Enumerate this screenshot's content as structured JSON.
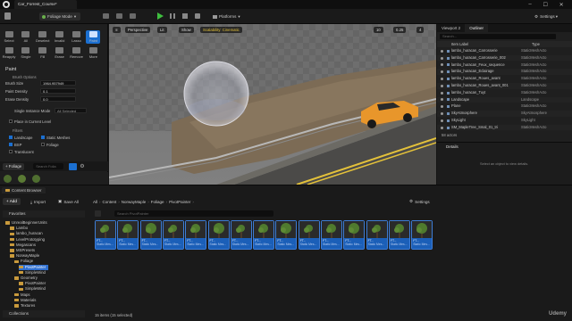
{
  "title_bar": {
    "tab": "Car_Forrest_Course*",
    "mode": "Foliage Mode"
  },
  "toolbar": {
    "platforms": "Platforms",
    "settings": "Settings"
  },
  "tools": [
    {
      "label": "Select"
    },
    {
      "label": "All"
    },
    {
      "label": "Deselect"
    },
    {
      "label": "Invalid"
    },
    {
      "label": "Lasso"
    },
    {
      "label": "Paint"
    },
    {
      "label": "Reapply"
    },
    {
      "label": "Single"
    },
    {
      "label": "Fill"
    },
    {
      "label": "Erase"
    },
    {
      "label": "Remove"
    },
    {
      "label": "More"
    }
  ],
  "paint": {
    "title": "Paint",
    "brush_options": "Brush Options",
    "brush_size_label": "Brush Size",
    "brush_size": "1964.957949",
    "paint_density_label": "Paint Density",
    "paint_density": "0.1",
    "erase_density_label": "Erase Density",
    "erase_density": "0.0",
    "single_instance_label": "Single Instance Mode",
    "single_instance_value": "All Selected",
    "place_label": "Place in Current Level",
    "filters": "Filters",
    "f_landscape": "Landscape",
    "f_static": "Static Meshes",
    "f_bsp": "BSP",
    "f_foliage": "Foliage",
    "f_translucent": "Translucent"
  },
  "foliage_bar": {
    "button": "+ Foliage",
    "search_placeholder": "Search Folia"
  },
  "viewport": {
    "perspective": "Perspective",
    "lit": "Lit",
    "show": "Show",
    "scalability": "Scalability: Cinematic",
    "fov": "10",
    "snap1": "0.25",
    "snap2": "4"
  },
  "outliner": {
    "tab1": "Viewport 2",
    "tab2": "Outliner",
    "search_placeholder": "Search...",
    "col_label": "Item Label",
    "col_type": "Type",
    "rows": [
      {
        "label": "lambo_huracan_Carrosserie",
        "type": "StaticMeshActo"
      },
      {
        "label": "lambo_huracan_Carrosserie_002",
        "type": "StaticMeshActo"
      },
      {
        "label": "lambo_huracan_Feux_sequence",
        "type": "StaticMeshActo"
      },
      {
        "label": "lambo_huracan_Eclairage",
        "type": "StaticMeshActo"
      },
      {
        "label": "lambo_huracan_Roues_avant",
        "type": "StaticMeshActo"
      },
      {
        "label": "lambo_huracan_Roues_avant_001",
        "type": "StaticMeshActo"
      },
      {
        "label": "lambo_huracan_Tuyt",
        "type": "StaticMeshActo"
      },
      {
        "label": "Landscape",
        "type": "Landscape"
      },
      {
        "label": "Plane",
        "type": "StaticMeshActo"
      },
      {
        "label": "SkyAtmosphere",
        "type": "SkyAtmosphere"
      },
      {
        "label": "SkyLight",
        "type": "SkyLight"
      },
      {
        "label": "SM_MapleTree_Smal_01_tri",
        "type": "StaticMeshActo"
      }
    ],
    "actor_count": "58 actors"
  },
  "details": {
    "tab": "Details",
    "empty": "Select an object to view details."
  },
  "content_browser": {
    "tab": "Content Browser",
    "add": "+ Add",
    "import": "Import",
    "save_all": "Save All",
    "breadcrumb": [
      "All",
      "Content",
      "NorwayMaple",
      "Foliage",
      "PivotPainter"
    ],
    "settings": "Settings",
    "favorites": "Favorites",
    "search_placeholder": "Search PivotPainter",
    "tree": [
      {
        "label": "UnrealBeginnerUnits",
        "indent": 0,
        "selected": false
      },
      {
        "label": "Lambo",
        "indent": 1,
        "selected": false
      },
      {
        "label": "lambo_huracan",
        "indent": 1,
        "selected": false
      },
      {
        "label": "LevelPrototyping",
        "indent": 1,
        "selected": false
      },
      {
        "label": "Megascans",
        "indent": 1,
        "selected": false
      },
      {
        "label": "MSPresets",
        "indent": 1,
        "selected": false
      },
      {
        "label": "NorwayMaple",
        "indent": 1,
        "selected": false
      },
      {
        "label": "Foliage",
        "indent": 2,
        "selected": false
      },
      {
        "label": "PivotPainter",
        "indent": 3,
        "selected": true
      },
      {
        "label": "SimpleWind",
        "indent": 3,
        "selected": false
      },
      {
        "label": "Geometry",
        "indent": 2,
        "selected": false
      },
      {
        "label": "PivotPainter",
        "indent": 3,
        "selected": false
      },
      {
        "label": "SimpleWind",
        "indent": 3,
        "selected": false
      },
      {
        "label": "Maps",
        "indent": 2,
        "selected": false
      },
      {
        "label": "Materials",
        "indent": 2,
        "selected": false
      },
      {
        "label": "Textures",
        "indent": 2,
        "selected": false
      }
    ],
    "collections": "Collections",
    "assets": [
      {
        "name": "FT...",
        "type": "Static Mes..."
      },
      {
        "name": "FT...",
        "type": "Static Mes..."
      },
      {
        "name": "FT...",
        "type": "Static Mes..."
      },
      {
        "name": "FT...",
        "type": "Static Mes..."
      },
      {
        "name": "FT...",
        "type": "Static Mes..."
      },
      {
        "name": "FT...",
        "type": "Static Mes..."
      },
      {
        "name": "FT...",
        "type": "Static Mes..."
      },
      {
        "name": "FT...",
        "type": "Static Mes..."
      },
      {
        "name": "FT...",
        "type": "Static Mes..."
      },
      {
        "name": "FT...",
        "type": "Static Mes..."
      },
      {
        "name": "FT...",
        "type": "Static Mes..."
      },
      {
        "name": "FT...",
        "type": "Static Mes..."
      },
      {
        "name": "FT...",
        "type": "Static Mes..."
      },
      {
        "name": "FT...",
        "type": "Static Mes..."
      },
      {
        "name": "FT...",
        "type": "Static Mes..."
      }
    ],
    "status": "15 items (15 selected)"
  },
  "watermark": "Udemy",
  "colors": {
    "accent": "#1b6fd0",
    "selection": "#1b5fb8",
    "play": "#3fbf3f",
    "car": "#e8962b"
  }
}
